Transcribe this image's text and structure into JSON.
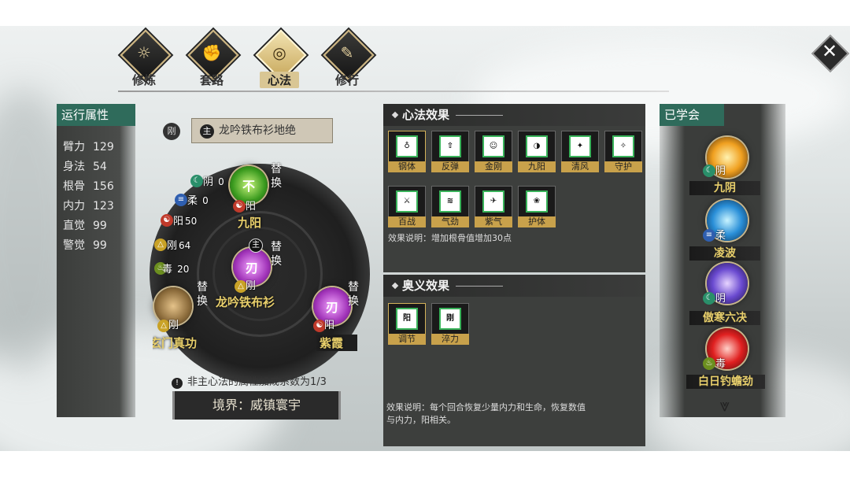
{
  "nav": {
    "tabs": [
      {
        "label": "修炼",
        "icon": "sun-icon"
      },
      {
        "label": "套路",
        "icon": "fist-icon"
      },
      {
        "label": "心法",
        "icon": "spiral-icon",
        "active": true
      },
      {
        "label": "修行",
        "icon": "scroll-icon"
      }
    ],
    "close_glyph": "✕"
  },
  "stats": {
    "title": "运行属性",
    "items": [
      {
        "label": "臂力",
        "value": "129"
      },
      {
        "label": "身法",
        "value": "54"
      },
      {
        "label": "根骨",
        "value": "156"
      },
      {
        "label": "内力",
        "value": "123"
      },
      {
        "label": "直觉",
        "value": "99"
      },
      {
        "label": "警觉",
        "value": "99"
      }
    ]
  },
  "main": {
    "type_badge": "刚",
    "main_tag": "主",
    "main_label": "龙吟铁布衫地绝",
    "swap_label": "替换",
    "nodes": {
      "top": {
        "name": "九阳",
        "tag": "阳",
        "glyph": "不"
      },
      "center": {
        "name": "龙吟铁布衫",
        "tag": "刚",
        "main": "主",
        "glyph": "刃"
      },
      "left": {
        "name": "玄门真功",
        "tag": "刚"
      },
      "right": {
        "name": "紫霞",
        "tag": "阳",
        "glyph": "刃"
      }
    },
    "attributes": [
      {
        "name": "阴",
        "value": "0",
        "color": "#2a8f6a"
      },
      {
        "name": "柔",
        "value": "0",
        "color": "#2f5fb0"
      },
      {
        "name": "阳",
        "value": "50",
        "color": "#c03a2b"
      },
      {
        "name": "刚",
        "value": "64",
        "color": "#c9a227"
      },
      {
        "name": "毒",
        "value": "20",
        "color": "#6c8f1f"
      }
    ],
    "note": "非主心法的属性加成系数为1/3",
    "note_icon": "!",
    "realm": "境界：威镇寰宇"
  },
  "effects": {
    "title": "心法效果",
    "items": [
      {
        "label": "钢体",
        "icon": "armor-icon"
      },
      {
        "label": "反弹",
        "icon": "bounce-icon"
      },
      {
        "label": "金刚",
        "icon": "figure-icon"
      },
      {
        "label": "九阳",
        "icon": "split-icon"
      },
      {
        "label": "清风",
        "icon": "wind-icon"
      },
      {
        "label": "守护",
        "icon": "guard-icon"
      },
      {
        "label": "百战",
        "icon": "swords-icon"
      },
      {
        "label": "气劲",
        "icon": "qi-icon"
      },
      {
        "label": "紫气",
        "icon": "purple-qi-icon"
      },
      {
        "label": "护体",
        "icon": "body-guard-icon"
      }
    ],
    "desc": "效果说明：增加根骨值增加30点"
  },
  "mystic": {
    "title": "奥义效果",
    "items": [
      {
        "label": "调节",
        "glyph": "阳"
      },
      {
        "label": "淬力",
        "glyph": "刚"
      }
    ],
    "desc_line1": "效果说明：每个回合恢复少量内力和生命，恢复数值",
    "desc_line2": "与内力，阳相关。"
  },
  "learned": {
    "title": "已学会",
    "items": [
      {
        "name": "九阴",
        "tag": "阴",
        "tag_color": "#2a8f6a"
      },
      {
        "name": "凌波",
        "tag": "柔",
        "tag_color": "#2f5fb0"
      },
      {
        "name": "傲寒六决",
        "tag": "阴",
        "tag_color": "#2a8f6a"
      },
      {
        "name": "白日钓蟾劲",
        "tag": "毒",
        "tag_color": "#6c8f1f"
      }
    ],
    "more_glyph": "⩔"
  }
}
